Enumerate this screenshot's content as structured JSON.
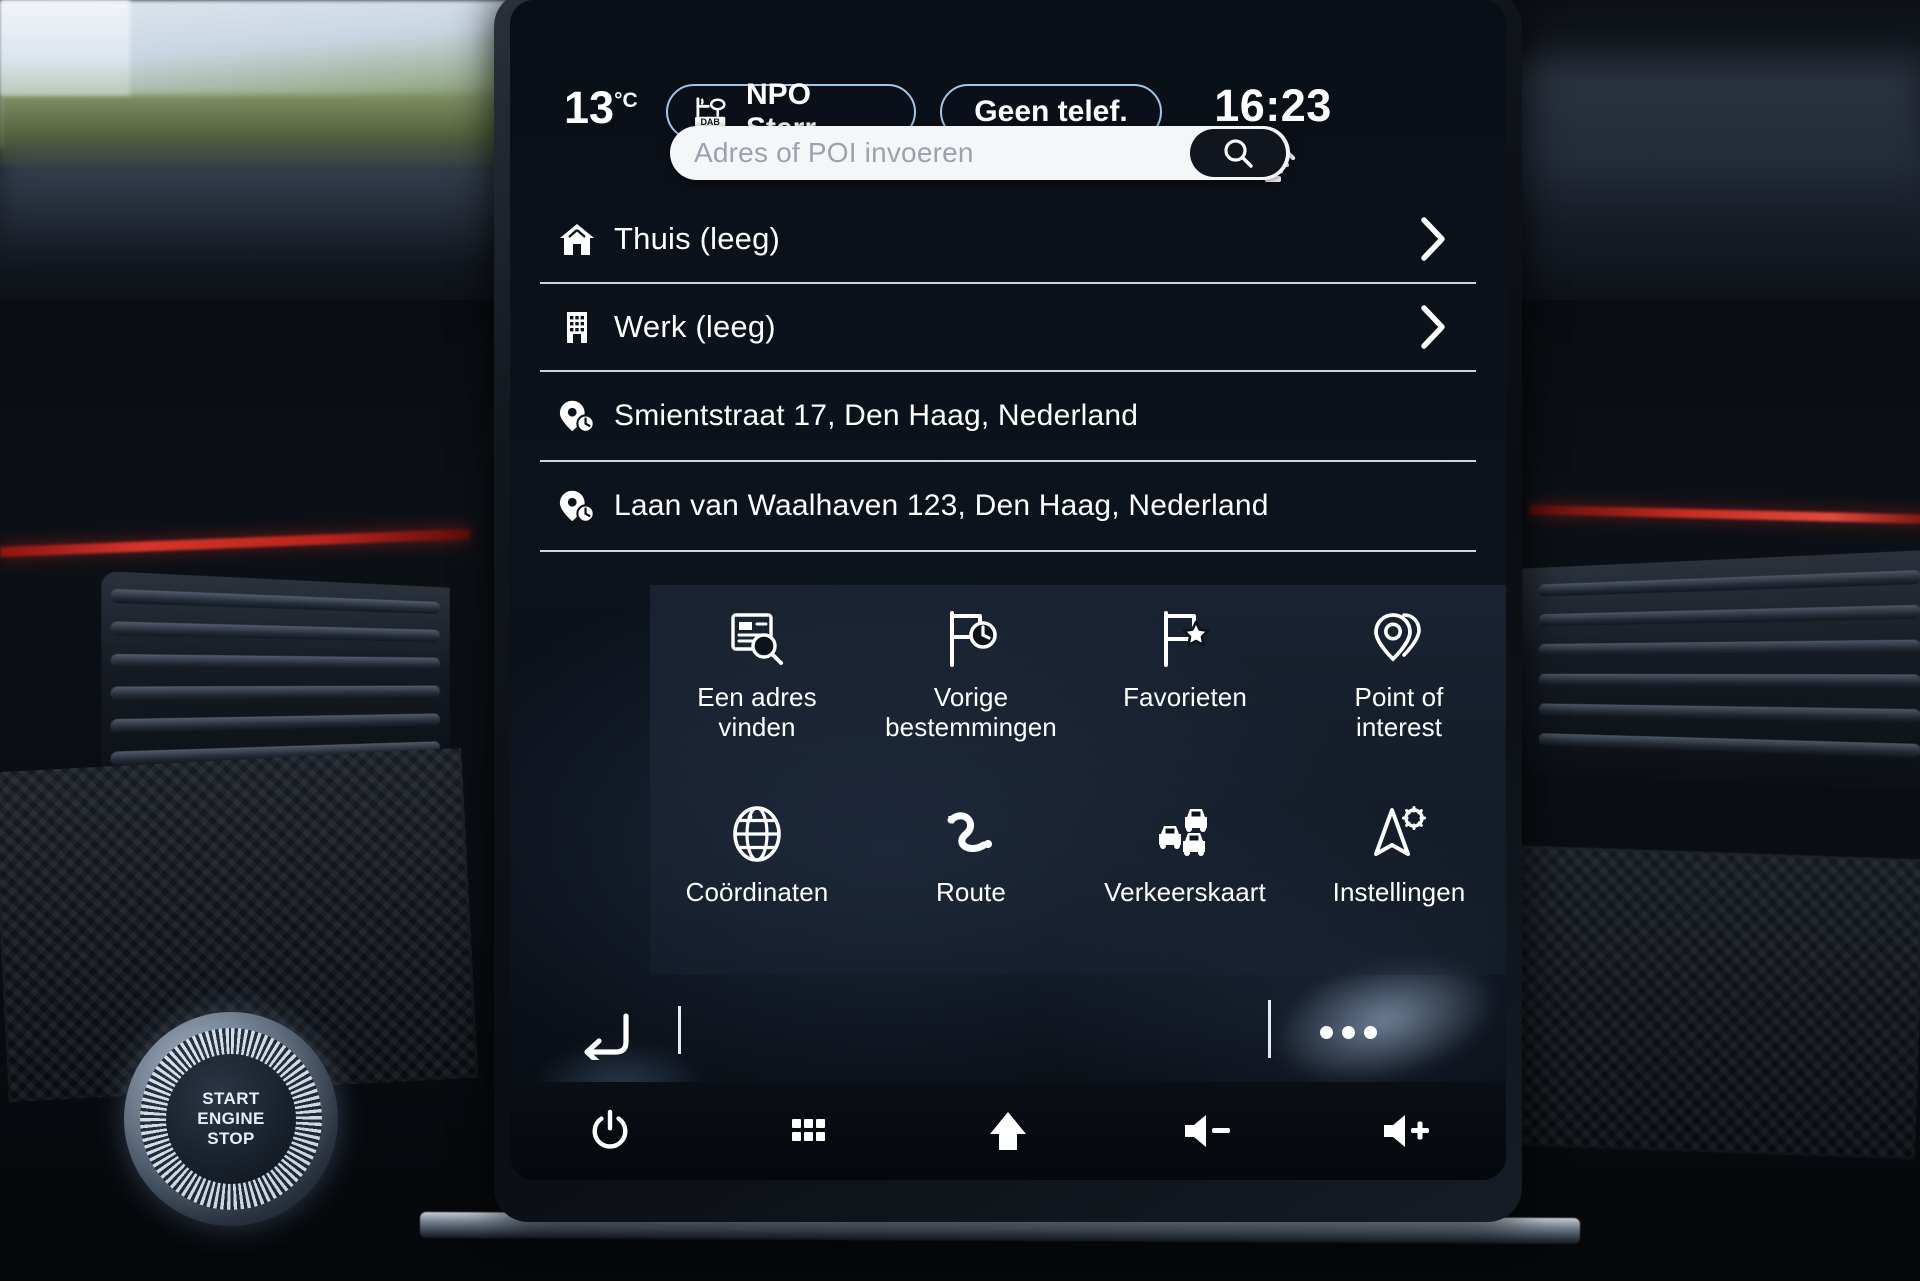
{
  "device": {
    "engine_button": {
      "line1": "START",
      "line2": "ENGINE",
      "line3": "STOP",
      "name": "start-stop-button"
    }
  },
  "status_bar": {
    "temperature": "13",
    "temperature_unit": "°C",
    "radio_pill": {
      "label": "NPO Sterr...",
      "icon": "dab-radio-icon"
    },
    "phone_pill": {
      "label": "Geen telef."
    },
    "clock": "16:23",
    "connectivity_icon": "wifi-icon"
  },
  "search": {
    "placeholder": "Adres of POI invoeren",
    "value": "",
    "button_icon": "search-icon"
  },
  "destinations": [
    {
      "label": "Thuis (leeg)",
      "icon": "home-icon",
      "chevron": true
    },
    {
      "label": "Werk (leeg)",
      "icon": "building-icon",
      "chevron": true
    },
    {
      "label": "Smientstraat 17, Den Haag, Nederland",
      "icon": "recent-location-icon",
      "chevron": false
    },
    {
      "label": "Laan van Waalhaven 123, Den Haag, Nederland",
      "icon": "recent-location-icon",
      "chevron": false
    }
  ],
  "menu_tiles": [
    {
      "label": "Een adres\nvinden",
      "icon": "address-search-icon"
    },
    {
      "label": "Vorige\nbestemmingen",
      "icon": "flag-clock-icon"
    },
    {
      "label": "Favorieten",
      "icon": "flag-star-icon"
    },
    {
      "label": "Point of\ninterest",
      "icon": "poi-pins-icon"
    },
    {
      "label": "Coördinaten",
      "icon": "globe-icon"
    },
    {
      "label": "Route",
      "icon": "route-icon"
    },
    {
      "label": "Verkeerskaart",
      "icon": "traffic-cars-icon"
    },
    {
      "label": "Instellingen",
      "icon": "navigation-settings-icon"
    }
  ],
  "action_bar": {
    "back_icon": "back-arrow-icon",
    "more_icon": "more-options-icon"
  },
  "bottom_bar": [
    {
      "icon": "power-icon",
      "name": "power-button"
    },
    {
      "icon": "apps-grid-icon",
      "name": "apps-button"
    },
    {
      "icon": "home-icon",
      "name": "home-button"
    },
    {
      "icon": "volume-down-icon",
      "name": "volume-down-button"
    },
    {
      "icon": "volume-up-icon",
      "name": "volume-up-button"
    }
  ],
  "colors": {
    "accent_pill_border": "#9fc6e8",
    "screen_bg": "#0a0f17",
    "text": "#ffffff",
    "placeholder": "#9aa3ad",
    "divider": "#cdd6e0",
    "trim_red": "#d7352a"
  }
}
